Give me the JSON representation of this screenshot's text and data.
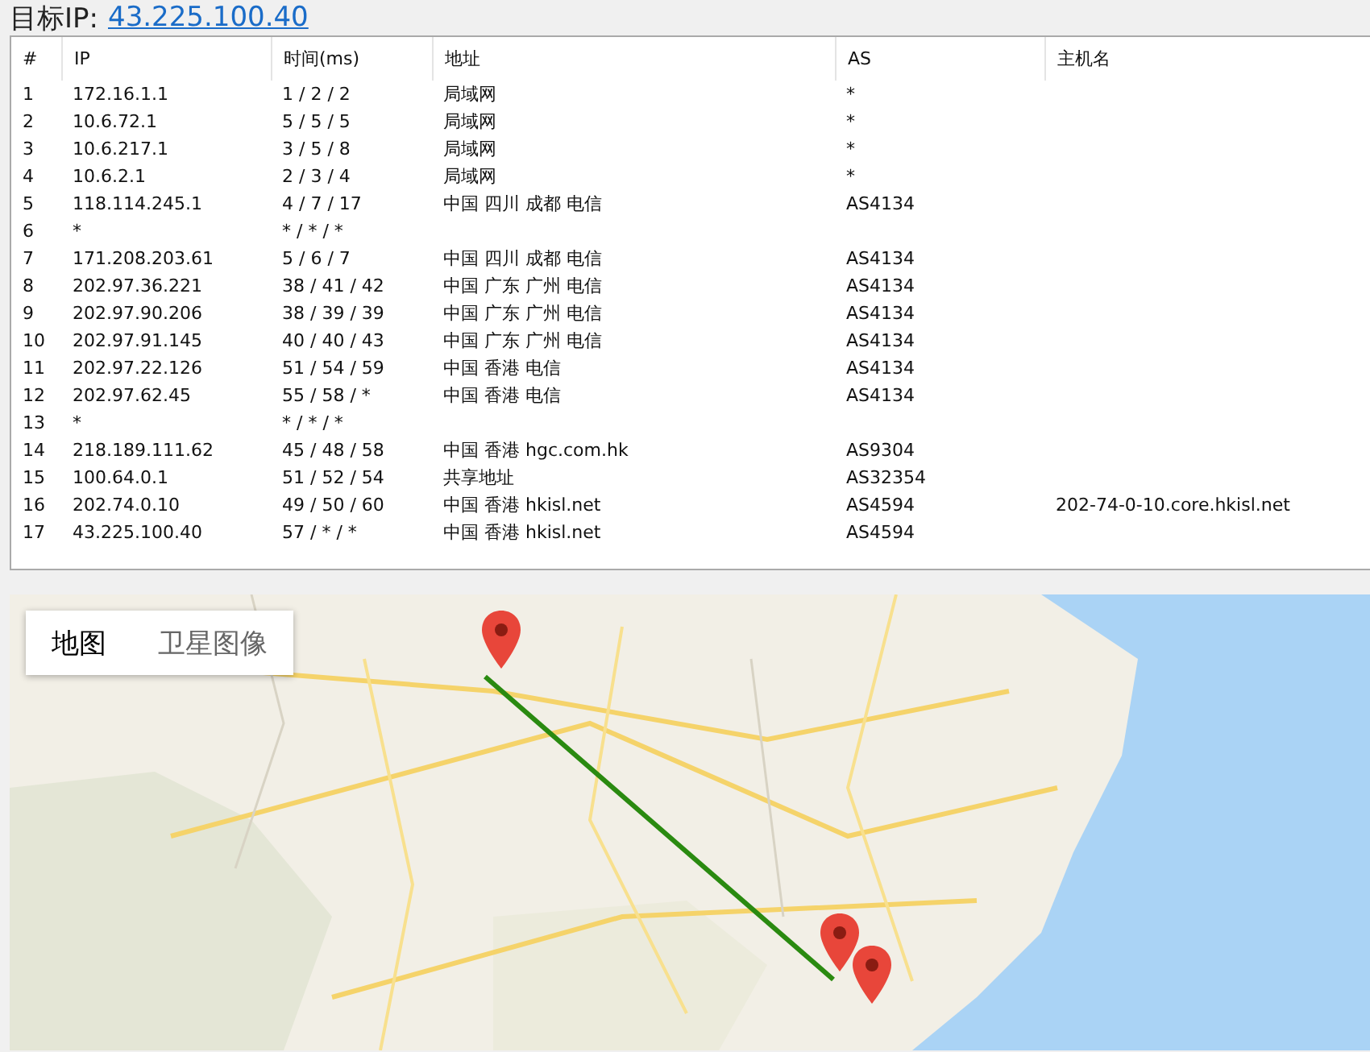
{
  "header": {
    "label": "目标IP:",
    "target_ip": "43.225.100.40"
  },
  "table": {
    "columns": [
      "#",
      "IP",
      "时间(ms)",
      "地址",
      "AS",
      "主机名"
    ],
    "rows": [
      {
        "hop": "1",
        "ip": "172.16.1.1",
        "time": "1 / 2 / 2",
        "address": "局域网",
        "as": "*"
      },
      {
        "hop": "2",
        "ip": "10.6.72.1",
        "time": "5 / 5 / 5",
        "address": "局域网",
        "as": "*"
      },
      {
        "hop": "3",
        "ip": "10.6.217.1",
        "time": "3 / 5 / 8",
        "address": "局域网",
        "as": "*"
      },
      {
        "hop": "4",
        "ip": "10.6.2.1",
        "time": "2 / 3 / 4",
        "address": "局域网",
        "as": "*"
      },
      {
        "hop": "5",
        "ip": "118.114.245.1",
        "time": "4 / 7 / 17",
        "address": "中国 四川 成都 电信",
        "as": "AS4134"
      },
      {
        "hop": "6",
        "ip": "*",
        "time": "* / * / *"
      },
      {
        "hop": "7",
        "ip": "171.208.203.61",
        "time": "5 / 6 / 7",
        "address": "中国 四川 成都 电信",
        "as": "AS4134"
      },
      {
        "hop": "8",
        "ip": "202.97.36.221",
        "time": "38 / 41 / 42",
        "address": "中国 广东 广州 电信",
        "as": "AS4134"
      },
      {
        "hop": "9",
        "ip": "202.97.90.206",
        "time": "38 / 39 / 39",
        "address": "中国 广东 广州 电信",
        "as": "AS4134"
      },
      {
        "hop": "10",
        "ip": "202.97.91.145",
        "time": "40 / 40 / 43",
        "address": "中国 广东 广州 电信",
        "as": "AS4134"
      },
      {
        "hop": "11",
        "ip": "202.97.22.126",
        "time": "51 / 54 / 59",
        "address": "中国 香港 电信",
        "as": "AS4134"
      },
      {
        "hop": "12",
        "ip": "202.97.62.45",
        "time": "55 / 58 / *",
        "address": "中国 香港 电信",
        "as": "AS4134"
      },
      {
        "hop": "13",
        "ip": "*",
        "time": "* / * / *"
      },
      {
        "hop": "14",
        "ip": "218.189.111.62",
        "time": "45 / 48 / 58",
        "address": "中国 香港 hgc.com.hk",
        "as": "AS9304"
      },
      {
        "hop": "15",
        "ip": "100.64.0.1",
        "time": "51 / 52 / 54",
        "address": "共享地址",
        "as": "AS32354"
      },
      {
        "hop": "16",
        "ip": "202.74.0.10",
        "time": "49 / 50 / 60",
        "address": "中国 香港 hkisl.net",
        "as": "AS4594",
        "host": "202-74-0-10.core.hkisl.net"
      },
      {
        "hop": "17",
        "ip": "43.225.100.40",
        "time": "57 / * / *",
        "address": "中国 香港 hkisl.net",
        "as": "AS4594"
      }
    ]
  },
  "map": {
    "kind": "picture",
    "map_types": [
      {
        "label": "地图",
        "selected": true
      },
      {
        "label": "卫星图像",
        "selected": false
      }
    ]
  }
}
